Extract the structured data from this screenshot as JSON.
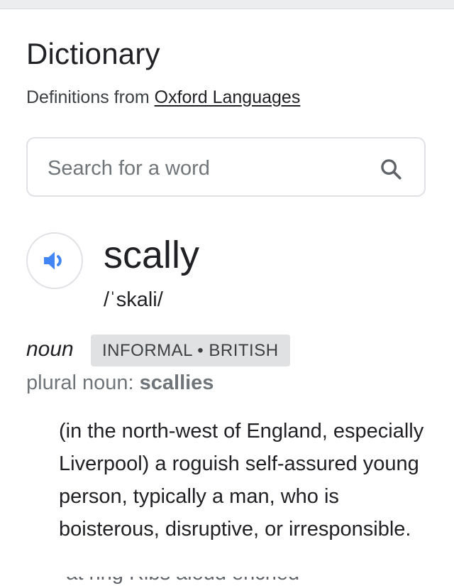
{
  "header": {
    "title": "Dictionary",
    "source_prefix": "Definitions from ",
    "source_link": "Oxford Languages"
  },
  "search": {
    "placeholder": "Search for a word",
    "icon": "search-icon"
  },
  "entry": {
    "audio_icon": "speaker-icon",
    "word": "scally",
    "phonetic": "/ˈskali/",
    "part_of_speech": "noun",
    "labels": "INFORMAL • BRITISH",
    "plural_label": "plural noun: ",
    "plural_value": "scallies",
    "definition": "(in the north-west of England, especially Liverpool) a roguish self-assured young person, typically a man, who is boisterous, disruptive, or irresponsible.",
    "next_line_partial": "\"at ring Ribs aloud enched\""
  },
  "colors": {
    "accent_blue": "#4285f4",
    "badge_bg": "#e0e1e3",
    "muted_text": "#70757a"
  }
}
